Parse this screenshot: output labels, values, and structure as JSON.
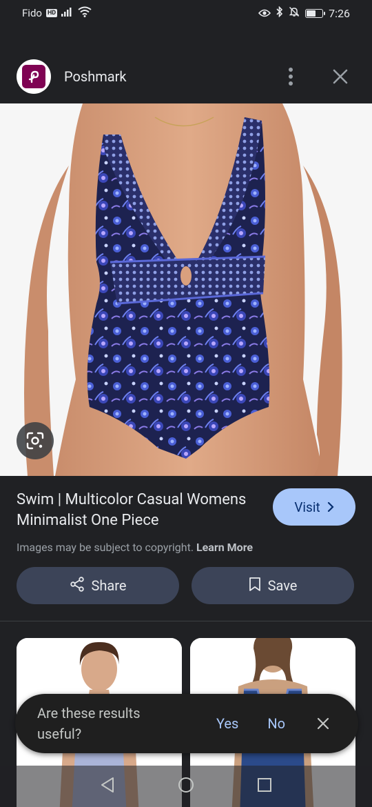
{
  "status_bar": {
    "carrier": "Fido",
    "hd_badge": "HD",
    "time": "7:26",
    "icons": [
      "signal-icon",
      "wifi-icon",
      "eye-icon",
      "bluetooth-icon",
      "mute-icon",
      "battery-icon"
    ]
  },
  "header": {
    "site_name": "Poshmark",
    "logo_icon": "poshmark-logo-icon",
    "menu_icon": "more-vert-icon",
    "close_icon": "close-icon"
  },
  "hero": {
    "image": "product-photo-swimsuit",
    "lens_icon": "google-lens-icon"
  },
  "result": {
    "title": "Swim | Multicolor Casual Womens Minimalist One Piece",
    "visit_label": "Visit",
    "copyright_text": "Images may be subject to copyright.",
    "learn_more": "Learn More",
    "share_label": "Share",
    "save_label": "Save"
  },
  "feedback": {
    "question": "Are these results useful?",
    "yes": "Yes",
    "no": "No"
  },
  "colors": {
    "background": "#202124",
    "accent": "#a8c7fa",
    "button_bg": "#3c4458",
    "brand": "#7f0353"
  }
}
